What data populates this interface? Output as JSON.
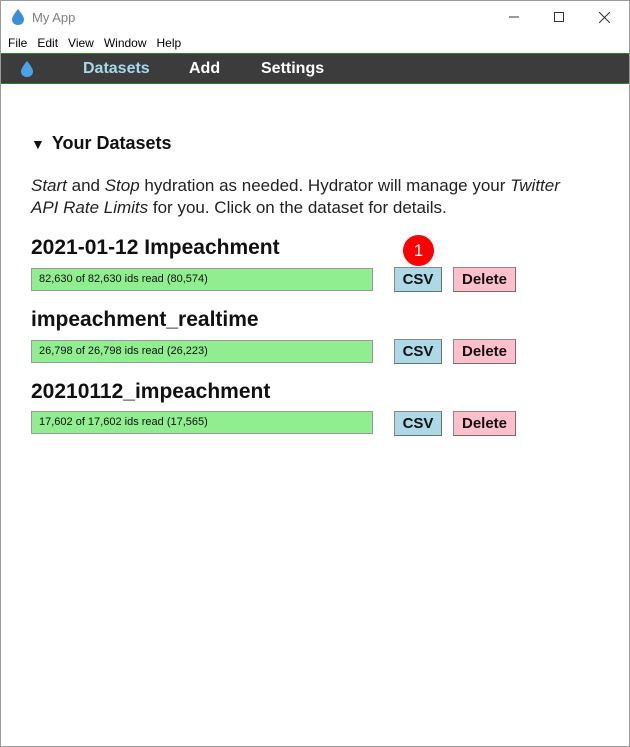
{
  "window": {
    "title": "My App"
  },
  "menubar": {
    "items": [
      "File",
      "Edit",
      "View",
      "Window",
      "Help"
    ]
  },
  "nav": {
    "logo_icon": "water-drop-icon",
    "links": [
      "Datasets",
      "Add",
      "Settings"
    ],
    "active": "Datasets"
  },
  "content": {
    "section_title": "Your Datasets",
    "intro": {
      "start": "Start",
      "and": " and ",
      "stop": "Stop",
      "rest1": " hydration as needed. Hydrator will manage your ",
      "limits": "Twitter API Rate Limits",
      "rest2": " for you. Click on the dataset for details."
    },
    "datasets": [
      {
        "name": "2021-01-12 Impeachment",
        "progress_text": "82,630 of 82,630 ids read (80,574)",
        "progress": 1.0,
        "csv_label": "CSV",
        "delete_label": "Delete"
      },
      {
        "name": "impeachment_realtime",
        "progress_text": "26,798 of 26,798 ids read (26,223)",
        "progress": 1.0,
        "csv_label": "CSV",
        "delete_label": "Delete"
      },
      {
        "name": "20210112_impeachment",
        "progress_text": "17,602 of 17,602 ids read (17,565)",
        "progress": 1.0,
        "csv_label": "CSV",
        "delete_label": "Delete"
      }
    ]
  },
  "annotation": {
    "badge_number": "1"
  },
  "colors": {
    "navbar_bg": "#3c3c3c",
    "nav_active": "#a8d8ea",
    "progress_fill": "#90ee90",
    "csv_button": "#add8e6",
    "delete_button": "#ffc0cb",
    "badge": "#ff0000"
  }
}
